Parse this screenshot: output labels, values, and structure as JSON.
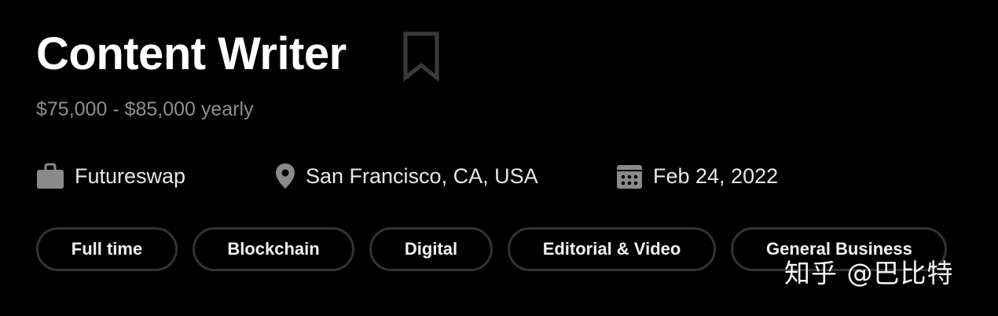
{
  "job": {
    "title": "Content Writer",
    "salary": "$75,000 - $85,000 yearly",
    "company": "Futureswap",
    "location": "San Francisco, CA, USA",
    "date": "Feb 24, 2022"
  },
  "icons": {
    "bookmark": "bookmark-icon",
    "company": "briefcase-icon",
    "location": "map-pin-icon",
    "date": "calendar-icon"
  },
  "tags": [
    "Full time",
    "Blockchain",
    "Digital",
    "Editorial & Video",
    "General Business"
  ],
  "watermark": "知乎 @巴比特",
  "colors": {
    "background": "#000000",
    "title": "#ffffff",
    "salary": "#8e8e8e",
    "meta_text": "#e8e8e8",
    "icon": "#8a8a8a",
    "tag_border": "#333333"
  }
}
